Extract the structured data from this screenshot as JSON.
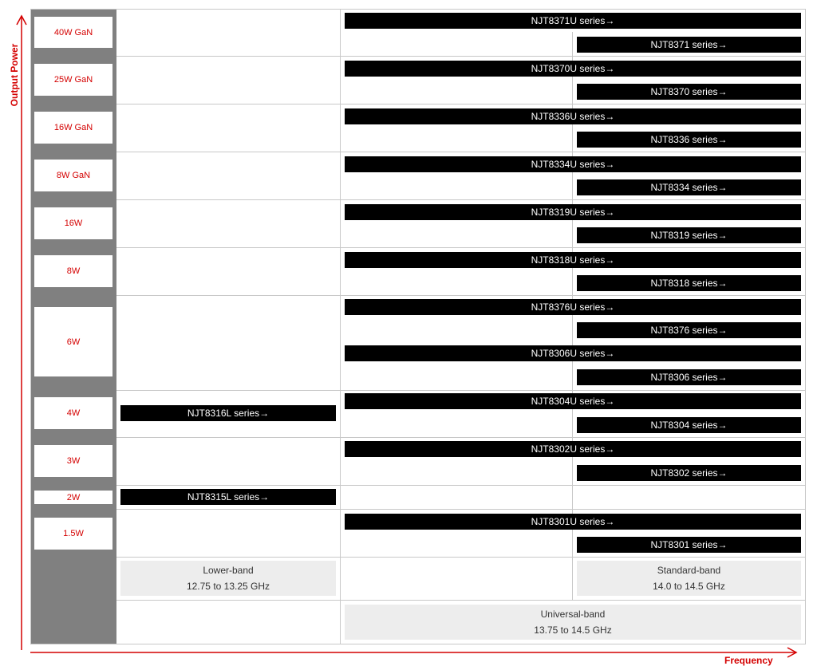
{
  "axes": {
    "y_label": "Output Power",
    "x_label": "Frequency",
    "color": "#d40000"
  },
  "power_levels": [
    "40W GaN",
    "25W GaN",
    "16W GaN",
    "8W GaN",
    "16W",
    "8W",
    "6W",
    "4W",
    "3W",
    "2W",
    "1.5W"
  ],
  "series": {
    "NJT8371U": "NJT8371U series→",
    "NJT8371": "NJT8371 series→",
    "NJT8370U": "NJT8370U series→",
    "NJT8370": "NJT8370 series→",
    "NJT8336U": "NJT8336U series→",
    "NJT8336": "NJT8336 series→",
    "NJT8334U": "NJT8334U series→",
    "NJT8334": "NJT8334 series→",
    "NJT8319U": "NJT8319U series→",
    "NJT8319": "NJT8319 series→",
    "NJT8318U": "NJT8318U series→",
    "NJT8318": "NJT8318 series→",
    "NJT8376U": "NJT8376U series→",
    "NJT8376": "NJT8376 series→",
    "NJT8306U": "NJT8306U series→",
    "NJT8306": "NJT8306 series→",
    "NJT8316L": "NJT8316L series→",
    "NJT8304U": "NJT8304U series→",
    "NJT8304": "NJT8304 series→",
    "NJT8302U": "NJT8302U series→",
    "NJT8302": "NJT8302 series→",
    "NJT8315L": "NJT8315L series→",
    "NJT8301U": "NJT8301U series→",
    "NJT8301": "NJT8301 series→"
  },
  "bands": {
    "lower": {
      "name": "Lower-band",
      "range": "12.75 to 13.25 GHz"
    },
    "standard": {
      "name": "Standard-band",
      "range": "14.0 to 14.5 GHz"
    },
    "universal": {
      "name": "Universal-band",
      "range": "13.75 to 14.5 GHz"
    }
  }
}
